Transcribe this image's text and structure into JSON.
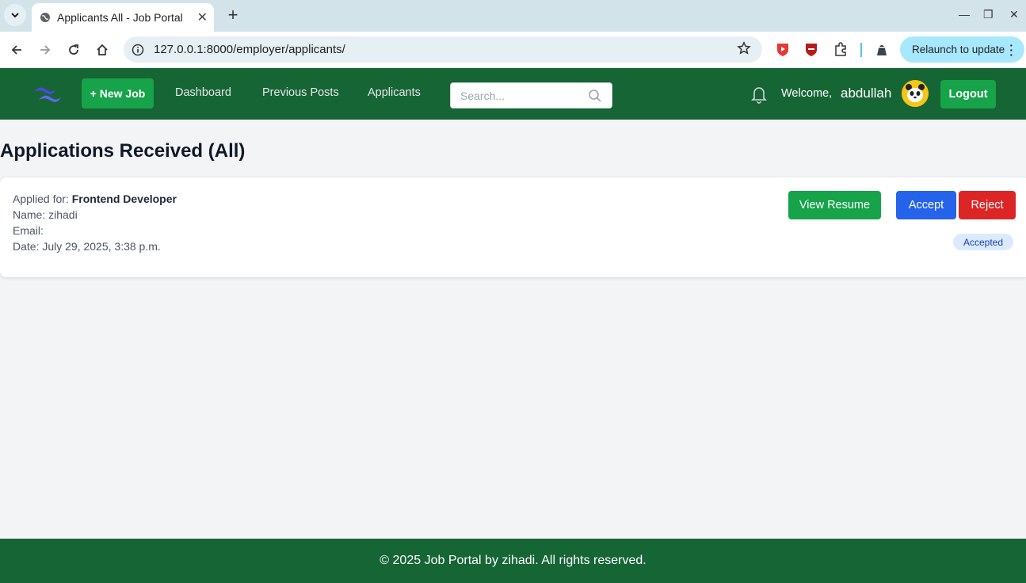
{
  "browser": {
    "tab_title": "Applicants All - Job Portal",
    "url": "127.0.0.1:8000/employer/applicants/",
    "relaunch_label": "Relaunch to update"
  },
  "navbar": {
    "new_job_label": "+ New Job",
    "links": [
      "Dashboard",
      "Previous Posts",
      "Applicants"
    ],
    "search_placeholder": "Search...",
    "welcome_label": "Welcome,",
    "username": "abdullah",
    "logout_label": "Logout"
  },
  "main": {
    "title": "Applications Received (All)",
    "applications": [
      {
        "applied_for_label": "Applied for:",
        "job_title": "Frontend Developer",
        "name_line": "Name: zihadi",
        "email_line": "Email:",
        "date_line": "Date: July 29, 2025, 3:38 p.m.",
        "view_resume_label": "View Resume",
        "accept_label": "Accept",
        "reject_label": "Reject",
        "status": "Accepted"
      }
    ]
  },
  "footer": {
    "text": "© 2025 Job Portal by zihadi. All rights reserved."
  },
  "colors": {
    "navbar": "#166534",
    "primary_green": "#16a34a",
    "accept_blue": "#2563eb",
    "reject_red": "#dc2626",
    "badge_bg": "#dbeafe"
  }
}
